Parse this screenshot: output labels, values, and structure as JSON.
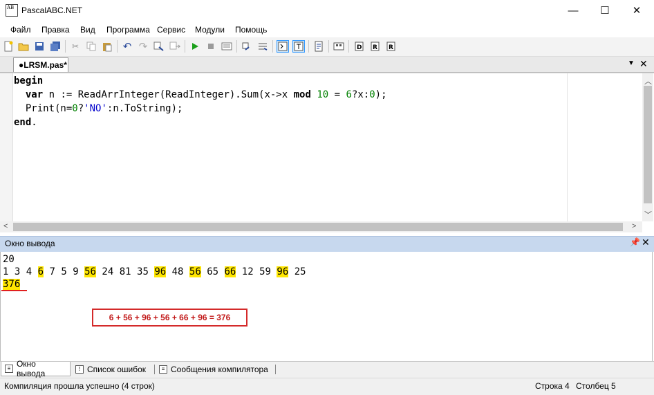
{
  "window": {
    "title": "PascalABC.NET",
    "icon_text": "AB",
    "minimize": "—",
    "maximize": "☐",
    "close": "✕"
  },
  "menu": [
    "Файл",
    "Правка",
    "Вид",
    "Программа",
    "Сервис",
    "Модули",
    "Помощь"
  ],
  "toolbar_icons": [
    "new-file-icon",
    "open-icon",
    "save-icon",
    "save-all-icon",
    "cut-icon",
    "copy-icon",
    "paste-icon",
    "undo-icon",
    "redo-icon",
    "find-icon",
    "replace-icon",
    "run-icon",
    "stop-icon",
    "debug-icon",
    "step-into-icon",
    "step-over-icon",
    "output-toggle-icon",
    "console-toggle-icon",
    "format-icon",
    "breakpoint-icon",
    "module-1-icon",
    "module-2-icon",
    "module-3-icon"
  ],
  "editor_tab": {
    "label": "●LRSM.pas*"
  },
  "code": {
    "line1_kw": "begin",
    "line2_indent": "  ",
    "line2_kw": "var",
    "line2_a": " n := ReadArrInteger(ReadInteger).Sum(x->x ",
    "line2_mod": "mod",
    "line2_sp": " ",
    "line2_num1": "10",
    "line2_b": " = ",
    "line2_num2": "6",
    "line2_c": "?x:",
    "line2_num3": "0",
    "line2_d": ");",
    "line3_a": "  Print(n=",
    "line3_num": "0",
    "line3_b": "?",
    "line3_str": "'NO'",
    "line3_c": ":n.ToString);",
    "line4_kw": "end",
    "line4_dot": "."
  },
  "output": {
    "header": "Окно вывода",
    "line1": "20",
    "tokens": [
      {
        "t": "1",
        "hl": false
      },
      {
        "t": "3",
        "hl": false
      },
      {
        "t": "4",
        "hl": false
      },
      {
        "t": "6",
        "hl": true
      },
      {
        "t": "7",
        "hl": false
      },
      {
        "t": "5",
        "hl": false
      },
      {
        "t": "9",
        "hl": false
      },
      {
        "t": "56",
        "hl": true
      },
      {
        "t": "24",
        "hl": false
      },
      {
        "t": "81",
        "hl": false
      },
      {
        "t": "35",
        "hl": false
      },
      {
        "t": "96",
        "hl": true
      },
      {
        "t": "48",
        "hl": false
      },
      {
        "t": "56",
        "hl": true
      },
      {
        "t": "65",
        "hl": false
      },
      {
        "t": "66",
        "hl": true
      },
      {
        "t": "12",
        "hl": false
      },
      {
        "t": "59",
        "hl": false
      },
      {
        "t": "96",
        "hl": true
      },
      {
        "t": "25",
        "hl": false
      }
    ],
    "result": "376",
    "annotation": "6 + 56 + 96 + 56 + 66 + 96 = 376",
    "highlight_color": "#ffe600",
    "annotation_color": "#d42a2a"
  },
  "bottom_tabs": [
    "Окно вывода",
    "Список ошибок",
    "Сообщения компилятора"
  ],
  "status": {
    "text": "Компиляция прошла успешно (4 строк)",
    "row": "Строка  4",
    "col": "Столбец  5"
  }
}
